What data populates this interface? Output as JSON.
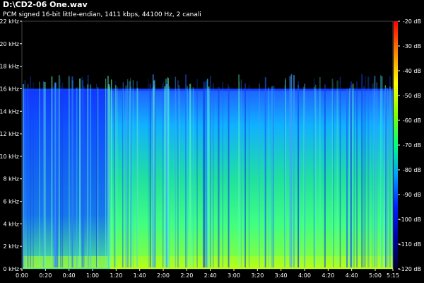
{
  "window": {
    "title": "D:\\CD2-06 One.wav",
    "subtitle": "PCM signed 16-bit little-endian, 1411 kbps, 44100 Hz, 2 canali"
  },
  "chart_data": {
    "type": "heatmap",
    "xlabel": "",
    "ylabel": "",
    "freq_axis": {
      "range_khz": [
        0,
        22
      ],
      "ticks": [
        "0 kHz",
        "2 kHz",
        "4 kHz",
        "6 kHz",
        "8 kHz",
        "10 kHz",
        "12 kHz",
        "14 kHz",
        "16 kHz",
        "18 kHz",
        "20 kHz",
        "22 kHz"
      ],
      "ticks_khz": [
        0,
        2,
        4,
        6,
        8,
        10,
        12,
        14,
        16,
        18,
        20,
        22
      ]
    },
    "time_axis": {
      "range_seconds": [
        0,
        315
      ],
      "ticks": [
        "0:00",
        "0:20",
        "0:40",
        "1:00",
        "1:20",
        "1:40",
        "2:00",
        "2:20",
        "2:40",
        "3:00",
        "3:20",
        "3:40",
        "4:00",
        "4:20",
        "4:40",
        "5:00",
        "5:15"
      ],
      "ticks_seconds": [
        0,
        20,
        40,
        60,
        80,
        100,
        120,
        140,
        160,
        180,
        200,
        220,
        240,
        260,
        280,
        300,
        315
      ]
    },
    "color_scale": {
      "range_db": [
        -120,
        -20
      ],
      "ticks": [
        "-20 dB",
        "-30 dB",
        "-40 dB",
        "-50 dB",
        "-60 dB",
        "-70 dB",
        "-80 dB",
        "-90 dB",
        "-100 dB",
        "-110 dB",
        "-120 dB"
      ],
      "ticks_db": [
        -20,
        -30,
        -40,
        -50,
        -60,
        -70,
        -80,
        -90,
        -100,
        -110,
        -120
      ],
      "colors": [
        "#ff0000",
        "#ff8000",
        "#ffff00",
        "#80ff00",
        "#00ff80",
        "#00c8ff",
        "#0060ff",
        "#0000c0",
        "#000040"
      ]
    },
    "cutoff_khz": 16
  }
}
